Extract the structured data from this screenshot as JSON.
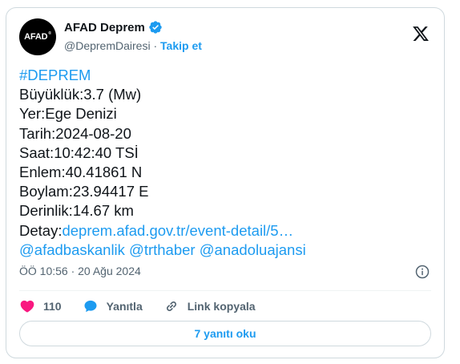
{
  "author": {
    "avatar_text": "AFAD",
    "avatar_mark": "®",
    "display_name": "AFAD Deprem",
    "handle": "@DepremDairesi",
    "separator": "·",
    "follow_label": "Takip et",
    "verified_color": "#1d9bf0"
  },
  "tweet": {
    "hashtag": "#DEPREM",
    "magnitude": "Büyüklük:3.7 (Mw)",
    "location": "Yer:Ege Denizi",
    "date": "Tarih:2024-08-20",
    "time": "Saat:10:42:40 TSİ",
    "latitude": "Enlem:40.41861 N",
    "longitude": "Boylam:23.94417 E",
    "depth": "Derinlik:14.67 km",
    "detail_prefix": "Detay:",
    "detail_link": "deprem.afad.gov.tr/event-detail/5…",
    "mentions": "@afadbaskanlik @trthaber @anadoluajansi",
    "timestamp": "ÖÖ 10:56 · 20 Ağu 2024"
  },
  "actions": {
    "likes": "110",
    "reply_label": "Yanıtla",
    "copy_link_label": "Link kopyala",
    "read_replies_label": "7 yanıtı oku"
  },
  "icons": {
    "verified": "verified-badge-icon",
    "platform": "x-logo-icon",
    "info": "info-icon",
    "like": "heart-icon",
    "reply": "speech-bubble-icon",
    "link": "link-icon"
  },
  "colors": {
    "accent": "#1d9bf0",
    "like": "#f91880",
    "text": "#0f1419",
    "muted": "#536471"
  }
}
